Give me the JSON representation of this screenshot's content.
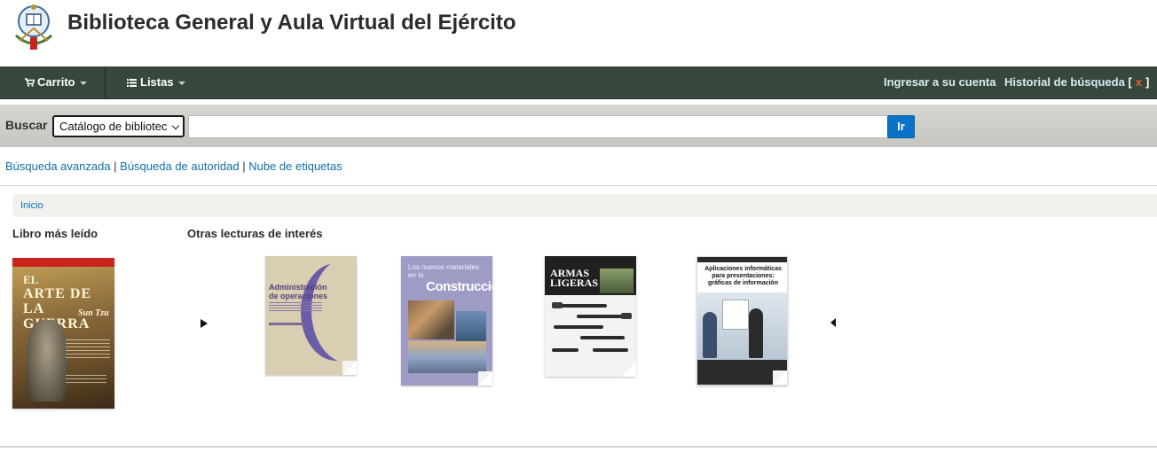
{
  "header": {
    "title": "Biblioteca General y Aula Virtual del Ejército"
  },
  "navbar": {
    "cart_label": "Carrito",
    "lists_label": "Listas",
    "login_label": "Ingresar a su cuenta",
    "history_label": "Historial de búsqueda",
    "history_open": "[",
    "history_clear": "x",
    "history_close": "]"
  },
  "search": {
    "label": "Buscar",
    "scope_selected": "Catálogo de bibliotec",
    "query_value": "",
    "button_label": "Ir"
  },
  "links": {
    "advanced": "Búsqueda avanzada",
    "authority": "Búsqueda de autoridad",
    "tags": "Nube de etiquetas",
    "separator": " | "
  },
  "breadcrumb": {
    "home": "Inicio"
  },
  "most_read": {
    "heading": "Libro más leído",
    "cover": {
      "line1": "EL",
      "line2": "ARTE DE LA GUERRA",
      "author": "Sun Tzu"
    }
  },
  "other_reading": {
    "heading": "Otras lecturas de interés",
    "books": [
      {
        "title": "Administración de operaciones"
      },
      {
        "title_small": "Los nuevos materiales en la",
        "title_big": "Construcción"
      },
      {
        "title": "ARMAS LIGERAS"
      },
      {
        "title": "Aplicaciones informáticas para presentaciones: gráficas de información"
      }
    ]
  }
}
